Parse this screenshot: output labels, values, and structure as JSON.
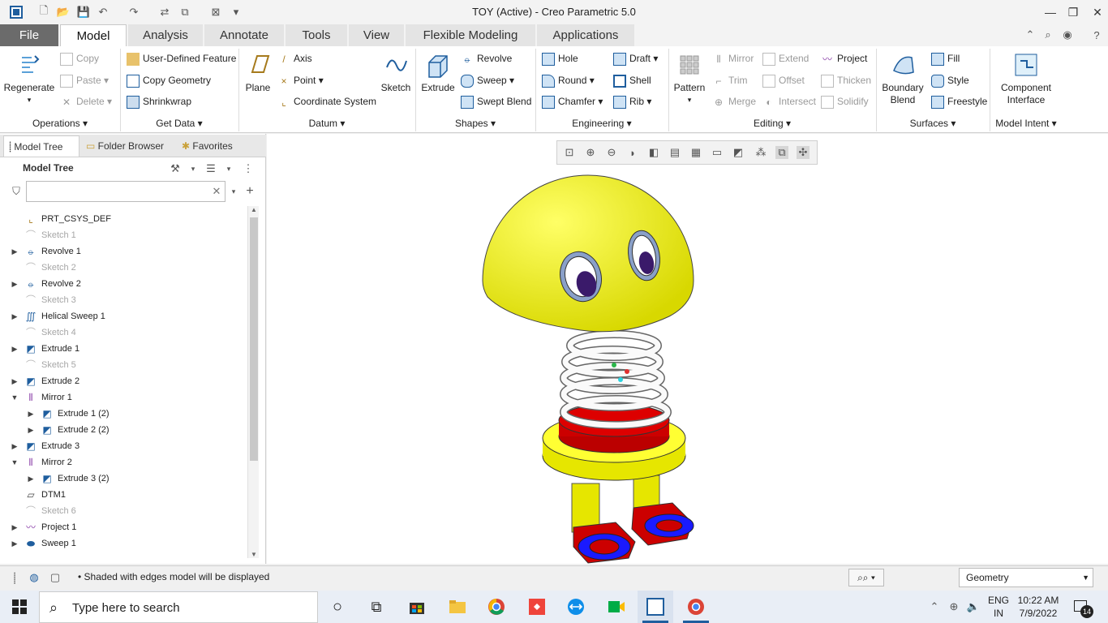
{
  "window": {
    "title": "TOY (Active) - Creo Parametric 5.0"
  },
  "tabs": [
    "File",
    "Model",
    "Analysis",
    "Annotate",
    "Tools",
    "View",
    "Flexible Modeling",
    "Applications"
  ],
  "ribbon": {
    "operations": {
      "regenerate": "Regenerate",
      "copy": "Copy",
      "paste": "Paste",
      "delete": "Delete",
      "group": "Operations"
    },
    "get_data": {
      "udf": "User-Defined Feature",
      "copy_geometry": "Copy Geometry",
      "shrinkwrap": "Shrinkwrap",
      "group": "Get Data"
    },
    "datum": {
      "plane": "Plane",
      "axis": "Axis",
      "point": "Point",
      "csys": "Coordinate System",
      "sketch": "Sketch",
      "group": "Datum"
    },
    "shapes": {
      "extrude": "Extrude",
      "revolve": "Revolve",
      "sweep": "Sweep",
      "swept_blend": "Swept Blend",
      "group": "Shapes"
    },
    "engineering": {
      "hole": "Hole",
      "round": "Round",
      "chamfer": "Chamfer",
      "draft": "Draft",
      "shell": "Shell",
      "rib": "Rib",
      "group": "Engineering"
    },
    "editing": {
      "pattern": "Pattern",
      "mirror": "Mirror",
      "trim": "Trim",
      "merge": "Merge",
      "extend": "Extend",
      "offset": "Offset",
      "intersect": "Intersect",
      "project": "Project",
      "thicken": "Thicken",
      "solidify": "Solidify",
      "group": "Editing"
    },
    "surfaces": {
      "boundary_blend_1": "Boundary",
      "boundary_blend_2": "Blend",
      "fill": "Fill",
      "style": "Style",
      "freestyle": "Freestyle",
      "group": "Surfaces"
    },
    "model_intent": {
      "component_1": "Component",
      "component_2": "Interface",
      "group": "Model Intent"
    }
  },
  "panel": {
    "tabs": [
      "Model Tree",
      "Folder Browser",
      "Favorites"
    ],
    "header": "Model Tree",
    "search_placeholder": "",
    "items": [
      {
        "label": "PRT_CSYS_DEF",
        "level": 0,
        "expand": "",
        "dim": false,
        "icon": "csys-icon"
      },
      {
        "label": "Sketch 1",
        "level": 0,
        "expand": "",
        "dim": true,
        "icon": "sketch-icon"
      },
      {
        "label": "Revolve 1",
        "level": 0,
        "expand": "▶",
        "dim": false,
        "icon": "revolve-icon"
      },
      {
        "label": "Sketch 2",
        "level": 0,
        "expand": "",
        "dim": true,
        "icon": "sketch-icon"
      },
      {
        "label": "Revolve 2",
        "level": 0,
        "expand": "▶",
        "dim": false,
        "icon": "revolve-icon"
      },
      {
        "label": "Sketch 3",
        "level": 0,
        "expand": "",
        "dim": true,
        "icon": "sketch-icon"
      },
      {
        "label": "Helical Sweep 1",
        "level": 0,
        "expand": "▶",
        "dim": false,
        "icon": "helical-sweep-icon"
      },
      {
        "label": "Sketch 4",
        "level": 0,
        "expand": "",
        "dim": true,
        "icon": "sketch-icon"
      },
      {
        "label": "Extrude 1",
        "level": 0,
        "expand": "▶",
        "dim": false,
        "icon": "extrude-icon"
      },
      {
        "label": "Sketch 5",
        "level": 0,
        "expand": "",
        "dim": true,
        "icon": "sketch-icon"
      },
      {
        "label": "Extrude 2",
        "level": 0,
        "expand": "▶",
        "dim": false,
        "icon": "extrude-icon"
      },
      {
        "label": "Mirror 1",
        "level": 0,
        "expand": "▼",
        "dim": false,
        "icon": "mirror-icon"
      },
      {
        "label": "Extrude 1 (2)",
        "level": 1,
        "expand": "▶",
        "dim": false,
        "icon": "extrude-icon"
      },
      {
        "label": "Extrude 2 (2)",
        "level": 1,
        "expand": "▶",
        "dim": false,
        "icon": "extrude-icon"
      },
      {
        "label": "Extrude 3",
        "level": 0,
        "expand": "▶",
        "dim": false,
        "icon": "extrude-icon"
      },
      {
        "label": "Mirror 2",
        "level": 0,
        "expand": "▼",
        "dim": false,
        "icon": "mirror-icon"
      },
      {
        "label": "Extrude 3 (2)",
        "level": 1,
        "expand": "▶",
        "dim": false,
        "icon": "extrude-icon"
      },
      {
        "label": "DTM1",
        "level": 0,
        "expand": "",
        "dim": false,
        "icon": "datum-plane-icon"
      },
      {
        "label": "Sketch 6",
        "level": 0,
        "expand": "",
        "dim": true,
        "icon": "sketch-icon"
      },
      {
        "label": "Project 1",
        "level": 0,
        "expand": "▶",
        "dim": false,
        "icon": "project-icon"
      },
      {
        "label": "Sweep 1",
        "level": 0,
        "expand": "▶",
        "dim": false,
        "icon": "sweep-icon"
      }
    ]
  },
  "status": {
    "message": "Shaded with edges model will be displayed",
    "filter": "Geometry"
  },
  "taskbar": {
    "search_placeholder": "Type here to search",
    "lang_1": "ENG",
    "lang_2": "IN",
    "time": "10:22 AM",
    "date": "7/9/2022",
    "notifications": "14"
  },
  "colors": {
    "yellow": "#ffff00",
    "red": "#cc0000",
    "blue": "#1a1aff",
    "file_tab": "#6b6b6b"
  }
}
